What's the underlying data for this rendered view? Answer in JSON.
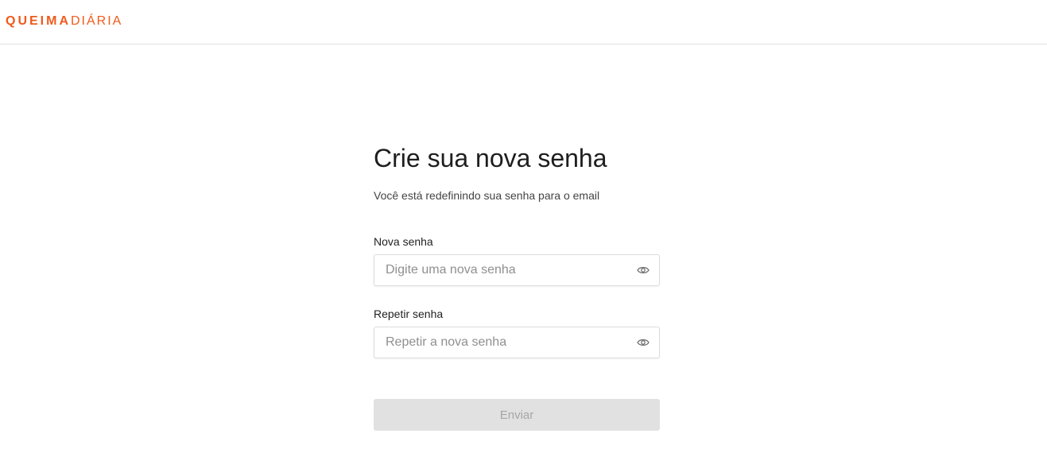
{
  "header": {
    "logo_bold": "QUEIMA",
    "logo_light": "DIÁRIA"
  },
  "form": {
    "title": "Crie sua nova senha",
    "subtitle": "Você está redefinindo sua senha para o email",
    "new_password": {
      "label": "Nova senha",
      "placeholder": "Digite uma nova senha",
      "value": ""
    },
    "repeat_password": {
      "label": "Repetir senha",
      "placeholder": "Repetir a nova senha",
      "value": ""
    },
    "submit_label": "Enviar",
    "submit_disabled": true
  },
  "icons": {
    "password_toggle": "eye-icon"
  },
  "colors": {
    "brand": "#f05a1a",
    "button_disabled_bg": "#e1e1e1",
    "button_disabled_text": "#a6a6a6"
  }
}
